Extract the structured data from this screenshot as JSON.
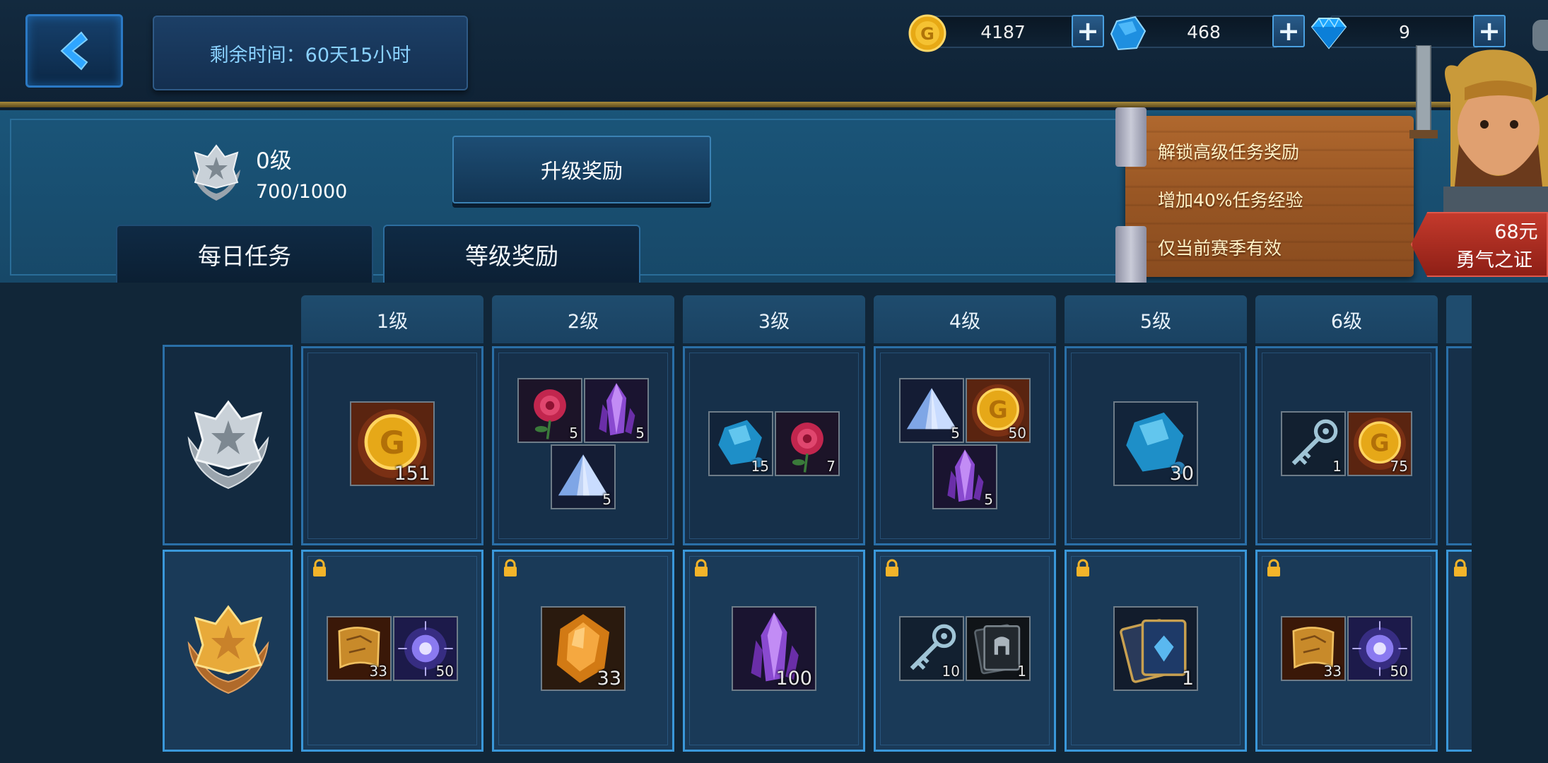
{
  "timer": {
    "label": "剩余时间：60天15小时"
  },
  "currencies": {
    "gold": {
      "value": "4187",
      "icon": "gold-coin-icon"
    },
    "crystal": {
      "value": "468",
      "icon": "blue-crystal-icon"
    },
    "diamond": {
      "value": "9",
      "icon": "diamond-icon"
    }
  },
  "rank": {
    "level": "0级",
    "xp": "700/1000"
  },
  "upgrade_button": "升级奖励",
  "tabs": {
    "daily": "每日任务",
    "level_rewards": "等级奖励"
  },
  "promo": {
    "lines": [
      "解锁高级任务奖励",
      "增加40%任务经验",
      "仅当前赛季有效"
    ],
    "price": "68元",
    "pass_name": "勇气之证"
  },
  "levels": [
    "1级",
    "2级",
    "3级",
    "4级",
    "5级",
    "6级"
  ],
  "free_rewards": [
    [
      {
        "icon": "gold-coin-icon",
        "qty": "151"
      }
    ],
    [
      {
        "icon": "rose-icon",
        "qty": "5"
      },
      {
        "icon": "purple-crystal-icon",
        "qty": "5"
      },
      {
        "icon": "ice-pyramid-icon",
        "qty": "5"
      }
    ],
    [
      {
        "icon": "blue-ore-icon",
        "qty": "15"
      },
      {
        "icon": "rose-icon",
        "qty": "7"
      }
    ],
    [
      {
        "icon": "ice-pyramid-icon",
        "qty": "5"
      },
      {
        "icon": "gold-coin-icon",
        "qty": "50"
      },
      {
        "icon": "purple-crystal-icon",
        "qty": "5"
      }
    ],
    [
      {
        "icon": "blue-ore-icon",
        "qty": "30"
      }
    ],
    [
      {
        "icon": "key-icon",
        "qty": "1"
      },
      {
        "icon": "gold-coin-icon",
        "qty": "75"
      }
    ]
  ],
  "premium_rewards": [
    [
      {
        "icon": "scroll-map-icon",
        "qty": "33"
      },
      {
        "icon": "magic-orb-icon",
        "qty": "50"
      }
    ],
    [
      {
        "icon": "amber-gem-icon",
        "qty": "33"
      }
    ],
    [
      {
        "icon": "purple-crystal-icon",
        "qty": "100"
      }
    ],
    [
      {
        "icon": "key-icon",
        "qty": "10"
      },
      {
        "icon": "helmet-card-icon",
        "qty": "1"
      }
    ],
    [
      {
        "icon": "card-pack-icon",
        "qty": "1"
      }
    ],
    [
      {
        "icon": "scroll-map-icon",
        "qty": "33"
      },
      {
        "icon": "magic-orb-icon",
        "qty": "50"
      }
    ]
  ]
}
